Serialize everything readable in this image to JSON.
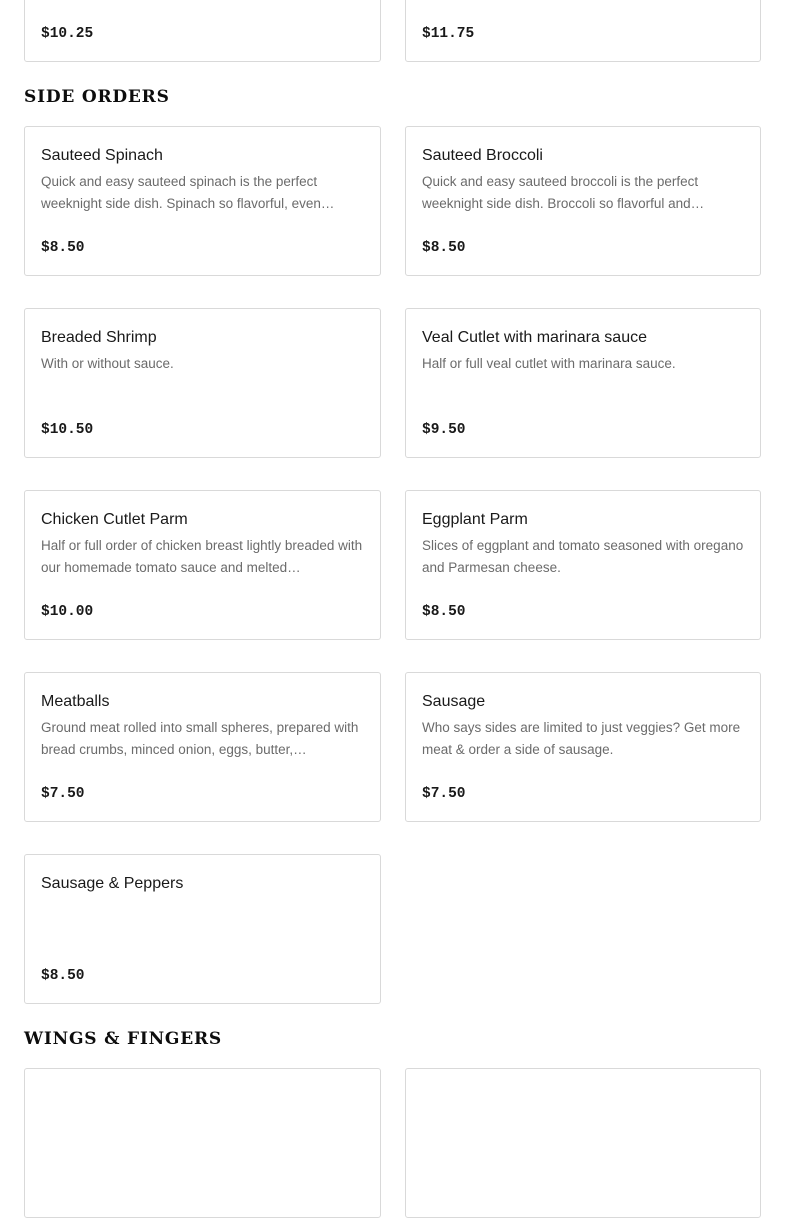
{
  "top_cards": {
    "left_price": "$10.25",
    "right_price": "$11.75"
  },
  "sections": {
    "side_orders": "SIDE ORDERS",
    "wings_fingers": "WINGS & FINGERS"
  },
  "side_orders": [
    {
      "name": "Sauteed Spinach",
      "description": "Quick and easy sauteed spinach is the perfect weeknight side dish. Spinach so flavorful, even…",
      "price": "$8.50"
    },
    {
      "name": "Sauteed Broccoli",
      "description": "Quick and easy sauteed broccoli is the perfect weeknight side dish. Broccoli so flavorful and…",
      "price": "$8.50"
    },
    {
      "name": "Breaded Shrimp",
      "description": "With or without sauce.",
      "price": "$10.50"
    },
    {
      "name": "Veal Cutlet with marinara sauce",
      "description": "Half or full veal cutlet with marinara sauce.",
      "price": "$9.50"
    },
    {
      "name": "Chicken Cutlet Parm",
      "description": "Half or full order of chicken breast lightly breaded with our homemade tomato sauce and melted…",
      "price": "$10.00"
    },
    {
      "name": "Eggplant Parm",
      "description": "Slices of eggplant and tomato seasoned with oregano and Parmesan cheese.",
      "price": "$8.50"
    },
    {
      "name": "Meatballs",
      "description": "Ground meat rolled into small spheres, prepared with bread crumbs, minced onion, eggs, butter,…",
      "price": "$7.50"
    },
    {
      "name": "Sausage",
      "description": "Who says sides are limited to just veggies? Get more meat & order a side of sausage.",
      "price": "$7.50"
    },
    {
      "name": "Sausage & Peppers",
      "description": "",
      "price": "$8.50"
    }
  ]
}
